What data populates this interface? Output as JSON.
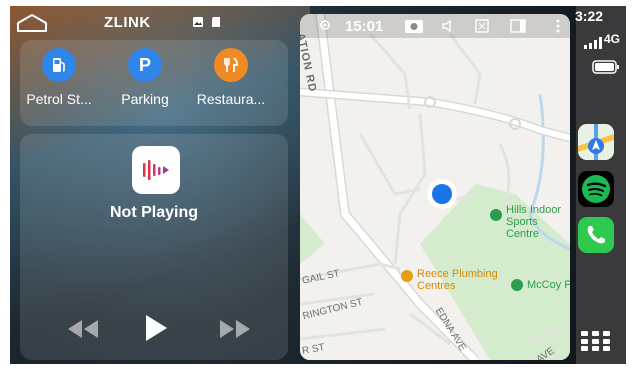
{
  "status_bar": {
    "title": "ZLINK",
    "icons": [
      "home-icon",
      "image-icon",
      "sd-card-icon"
    ]
  },
  "shortcuts": [
    {
      "label": "Petrol St...",
      "icon": "fuel-pump-icon",
      "color": "#2f86e8"
    },
    {
      "label": "Parking",
      "icon": "parking-icon",
      "color": "#2f86e8",
      "glyph": "P"
    },
    {
      "label": "Restaura...",
      "icon": "fork-knife-icon",
      "color": "#f08a24"
    }
  ],
  "now_playing": {
    "status": "Not Playing",
    "app_icon": "music-app-icon",
    "controls": [
      "rewind-icon",
      "play-icon",
      "fast-forward-icon"
    ]
  },
  "map": {
    "time": "15:01",
    "streets": [
      "ATION RD",
      "GAIL ST",
      "RINGTON ST",
      "R ST",
      "EDNA AVE",
      "AVE"
    ],
    "places": [
      {
        "name": "Hills Indoor",
        "name2": "Sports Centre",
        "color": "#2e9c4e"
      },
      {
        "name": "Reece Plumbing",
        "name2": "Centres",
        "color": "#e6a010"
      },
      {
        "name": "McCoy Par",
        "color": "#2e9c4e"
      }
    ],
    "toolbar_icons": [
      "location-icon",
      "screenshot-icon",
      "volume-icon",
      "close-box-icon",
      "window-icon",
      "more-icon"
    ]
  },
  "dock": {
    "time": "3:22",
    "network": "4G",
    "apps": [
      {
        "name": "Maps",
        "icon": "maps-icon"
      },
      {
        "name": "Spotify",
        "icon": "spotify-icon",
        "color": "#1db954"
      },
      {
        "name": "Phone",
        "icon": "phone-icon",
        "color": "#2fc94e"
      }
    ]
  }
}
